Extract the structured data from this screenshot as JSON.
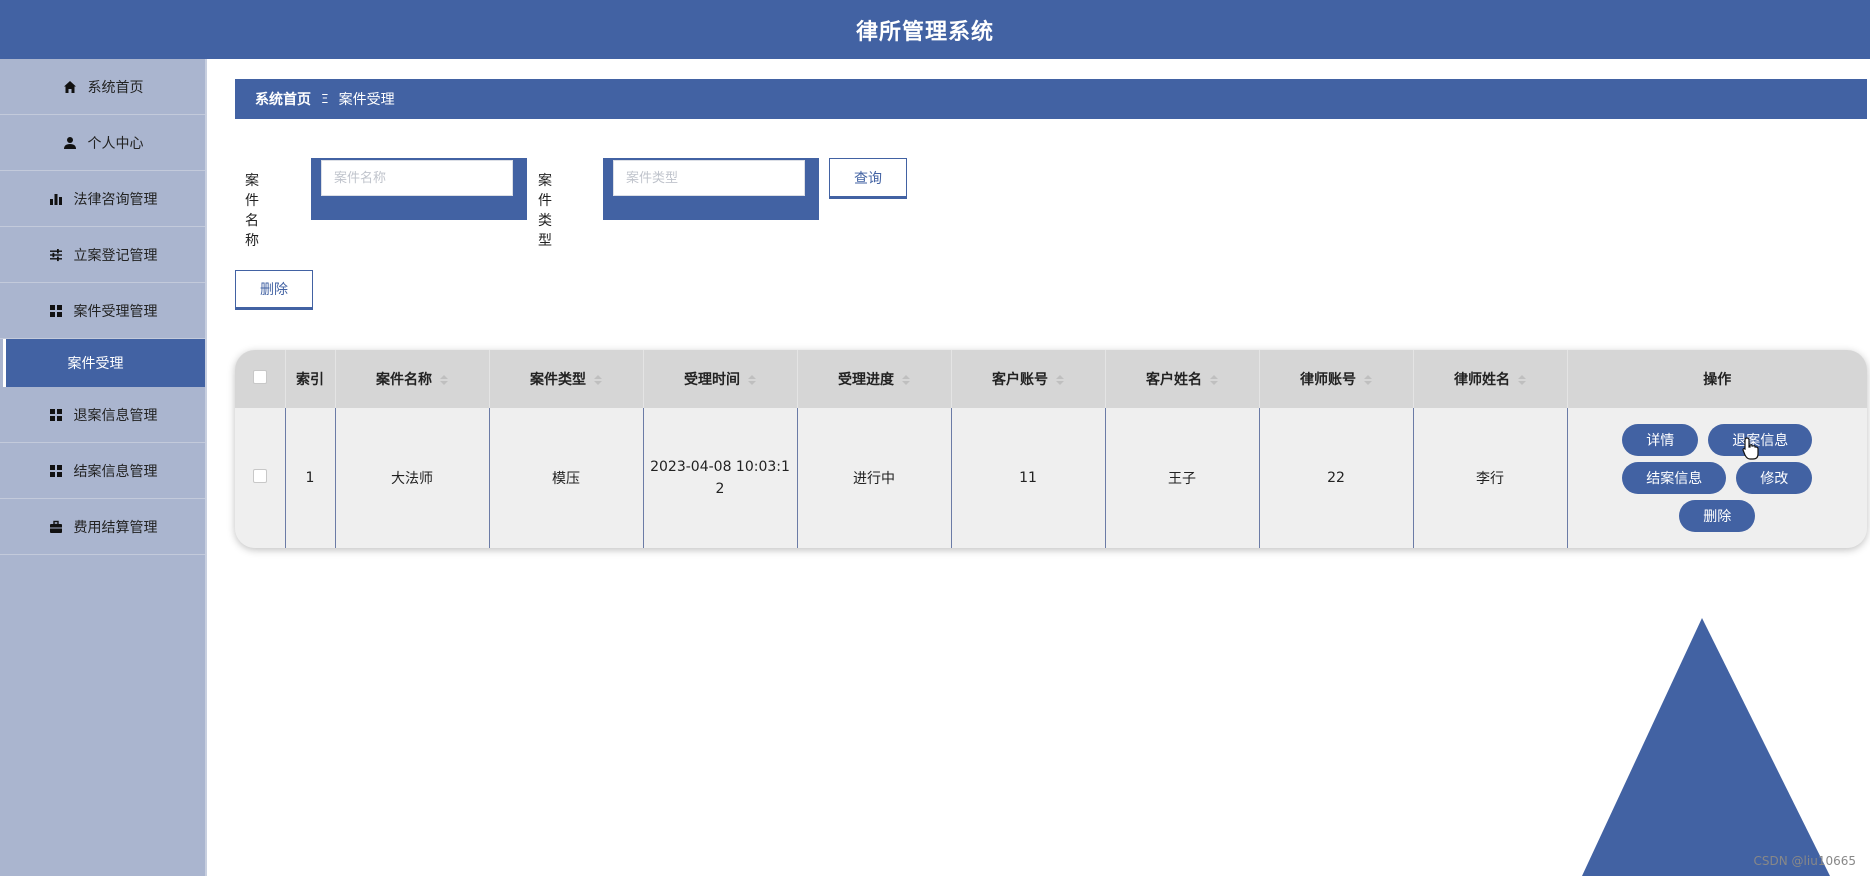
{
  "app": {
    "title": "律所管理系统"
  },
  "sidebar": {
    "items": [
      {
        "label": "系统首页",
        "icon": "home-icon"
      },
      {
        "label": "个人中心",
        "icon": "user-icon"
      },
      {
        "label": "法律咨询管理",
        "icon": "bar-chart-icon"
      },
      {
        "label": "立案登记管理",
        "icon": "sliders-icon"
      },
      {
        "label": "案件受理管理",
        "icon": "grid-icon"
      }
    ],
    "active_sub": "案件受理",
    "items_after": [
      {
        "label": "退案信息管理",
        "icon": "grid-icon"
      },
      {
        "label": "结案信息管理",
        "icon": "grid-icon"
      },
      {
        "label": "费用结算管理",
        "icon": "briefcase-icon"
      }
    ]
  },
  "breadcrumb": {
    "home": "系统首页",
    "separator": "Ξ",
    "current": "案件受理"
  },
  "search": {
    "name_label": "案件名称",
    "name_placeholder": "案件名称",
    "type_label": "案件类型",
    "type_placeholder": "案件类型",
    "query_button": "查询"
  },
  "toolbar": {
    "delete_button": "删除"
  },
  "table": {
    "headers": [
      "索引",
      "案件名称",
      "案件类型",
      "受理时间",
      "受理进度",
      "客户账号",
      "客户姓名",
      "律师账号",
      "律师姓名",
      "操作"
    ],
    "rows": [
      {
        "index": "1",
        "case_name": "大法师",
        "case_type": "模压",
        "accept_time_line1": "2023-04-08 10:03:1",
        "accept_time_line2": "2",
        "progress": "进行中",
        "client_account": "11",
        "client_name": "王子",
        "lawyer_account": "22",
        "lawyer_name": "李行",
        "actions": {
          "detail": "详情",
          "withdraw": "退案信息",
          "close": "结案信息",
          "edit": "修改",
          "delete": "删除"
        }
      }
    ]
  },
  "watermark": "CSDN @liu10665",
  "colors": {
    "primary": "#4262a3",
    "sidebar": "#aab5cf"
  }
}
